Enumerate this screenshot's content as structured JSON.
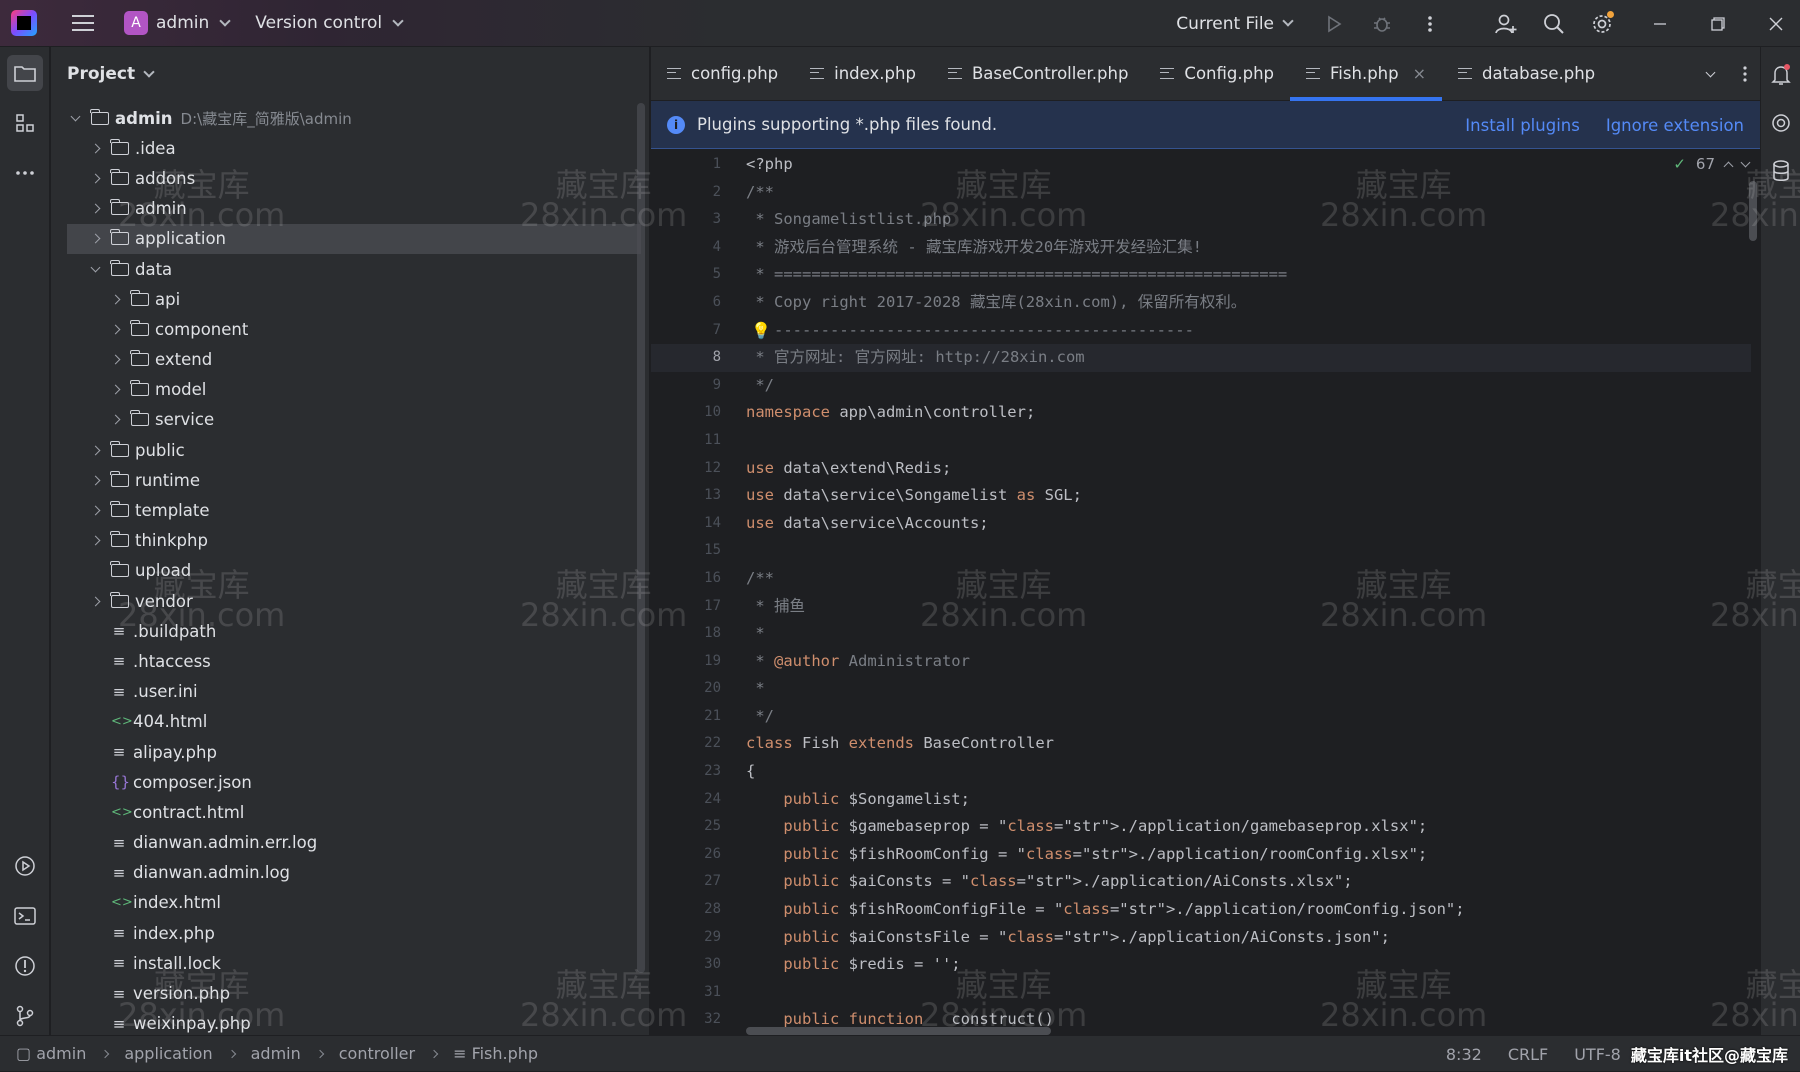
{
  "titlebar": {
    "project_initial": "A",
    "project_name": "admin",
    "vcs_label": "Version control",
    "run_config": "Current File"
  },
  "project_panel": {
    "title": "Project",
    "root_name": "admin",
    "root_path": "D:\\藏宝库_简雅版\\admin",
    "items": [
      {
        "label": ".idea",
        "type": "folder",
        "depth": 1,
        "expanded": false
      },
      {
        "label": "addons",
        "type": "folder",
        "depth": 1,
        "expanded": false
      },
      {
        "label": "admin",
        "type": "folder",
        "depth": 1,
        "expanded": false
      },
      {
        "label": "application",
        "type": "folder",
        "depth": 1,
        "expanded": false,
        "selected": true
      },
      {
        "label": "data",
        "type": "folder",
        "depth": 1,
        "expanded": true
      },
      {
        "label": "api",
        "type": "folder",
        "depth": 2,
        "expanded": false
      },
      {
        "label": "component",
        "type": "folder",
        "depth": 2,
        "expanded": false
      },
      {
        "label": "extend",
        "type": "folder",
        "depth": 2,
        "expanded": false
      },
      {
        "label": "model",
        "type": "folder",
        "depth": 2,
        "expanded": false
      },
      {
        "label": "service",
        "type": "folder",
        "depth": 2,
        "expanded": false
      },
      {
        "label": "public",
        "type": "folder",
        "depth": 1,
        "expanded": false
      },
      {
        "label": "runtime",
        "type": "folder",
        "depth": 1,
        "expanded": false
      },
      {
        "label": "template",
        "type": "folder",
        "depth": 1,
        "expanded": false
      },
      {
        "label": "thinkphp",
        "type": "folder",
        "depth": 1,
        "expanded": false
      },
      {
        "label": "upload",
        "type": "folder",
        "depth": 1,
        "noarrow": true
      },
      {
        "label": "vendor",
        "type": "folder",
        "depth": 1,
        "expanded": false
      },
      {
        "label": ".buildpath",
        "type": "text",
        "depth": 1
      },
      {
        "label": ".htaccess",
        "type": "text",
        "depth": 1
      },
      {
        "label": ".user.ini",
        "type": "text",
        "depth": 1
      },
      {
        "label": "404.html",
        "type": "html",
        "depth": 1
      },
      {
        "label": "alipay.php",
        "type": "text",
        "depth": 1
      },
      {
        "label": "composer.json",
        "type": "json",
        "depth": 1
      },
      {
        "label": "contract.html",
        "type": "html",
        "depth": 1
      },
      {
        "label": "dianwan.admin.err.log",
        "type": "text",
        "depth": 1
      },
      {
        "label": "dianwan.admin.log",
        "type": "text",
        "depth": 1
      },
      {
        "label": "index.html",
        "type": "html",
        "depth": 1
      },
      {
        "label": "index.php",
        "type": "text",
        "depth": 1
      },
      {
        "label": "install.lock",
        "type": "text",
        "depth": 1
      },
      {
        "label": "version.php",
        "type": "text",
        "depth": 1
      },
      {
        "label": "weixinpay.php",
        "type": "text",
        "depth": 1
      }
    ]
  },
  "tabs": [
    {
      "label": "config.php"
    },
    {
      "label": "index.php"
    },
    {
      "label": "BaseController.php"
    },
    {
      "label": "Config.php"
    },
    {
      "label": "Fish.php",
      "active": true
    },
    {
      "label": "database.php"
    }
  ],
  "banner": {
    "message": "Plugins supporting *.php files found.",
    "install_label": "Install plugins",
    "ignore_label": "Ignore extension"
  },
  "inspection": {
    "count": "67"
  },
  "code": {
    "current_line": 8,
    "lines": [
      "<?php",
      "/**",
      " * Songamelistlist.php",
      " * 游戏后台管理系统 - 藏宝库游戏开发20年游戏开发经验汇集!",
      " * =======================================================",
      " * Copy right 2017-2028 藏宝库(28xin.com), 保留所有权利。",
      " * ---------------------------------------------",
      " * 官方网址: 官方网址: http://28xin.com",
      " */",
      "namespace app\\admin\\controller;",
      "",
      "use data\\extend\\Redis;",
      "use data\\service\\Songamelist as SGL;",
      "use data\\service\\Accounts;",
      "",
      "/**",
      " * 捕鱼",
      " *",
      " * @author Administrator",
      " *",
      " */",
      "class Fish extends BaseController",
      "{",
      "    public $Songamelist;",
      "    public $gamebaseprop = \"./application/gamebaseprop.xlsx\";",
      "    public $fishRoomConfig = \"./application/roomConfig.xlsx\";",
      "    public $aiConsts = \"./application/AiConsts.xlsx\";",
      "    public $fishRoomConfigFile = \"./application/roomConfig.json\";",
      "    public $aiConstsFile = \"./application/AiConsts.json\";",
      "    public $redis = '';",
      "",
      "    public function __construct()"
    ]
  },
  "statusbar": {
    "breadcrumb": [
      "admin",
      "application",
      "admin",
      "controller",
      "Fish.php"
    ],
    "position": "8:32",
    "line_ending": "CRLF",
    "encoding": "UTF-8",
    "overlay_text": "藏宝库it社区@藏宝库"
  },
  "watermark": {
    "line1": "藏宝库",
    "line2": "28xin.com"
  }
}
